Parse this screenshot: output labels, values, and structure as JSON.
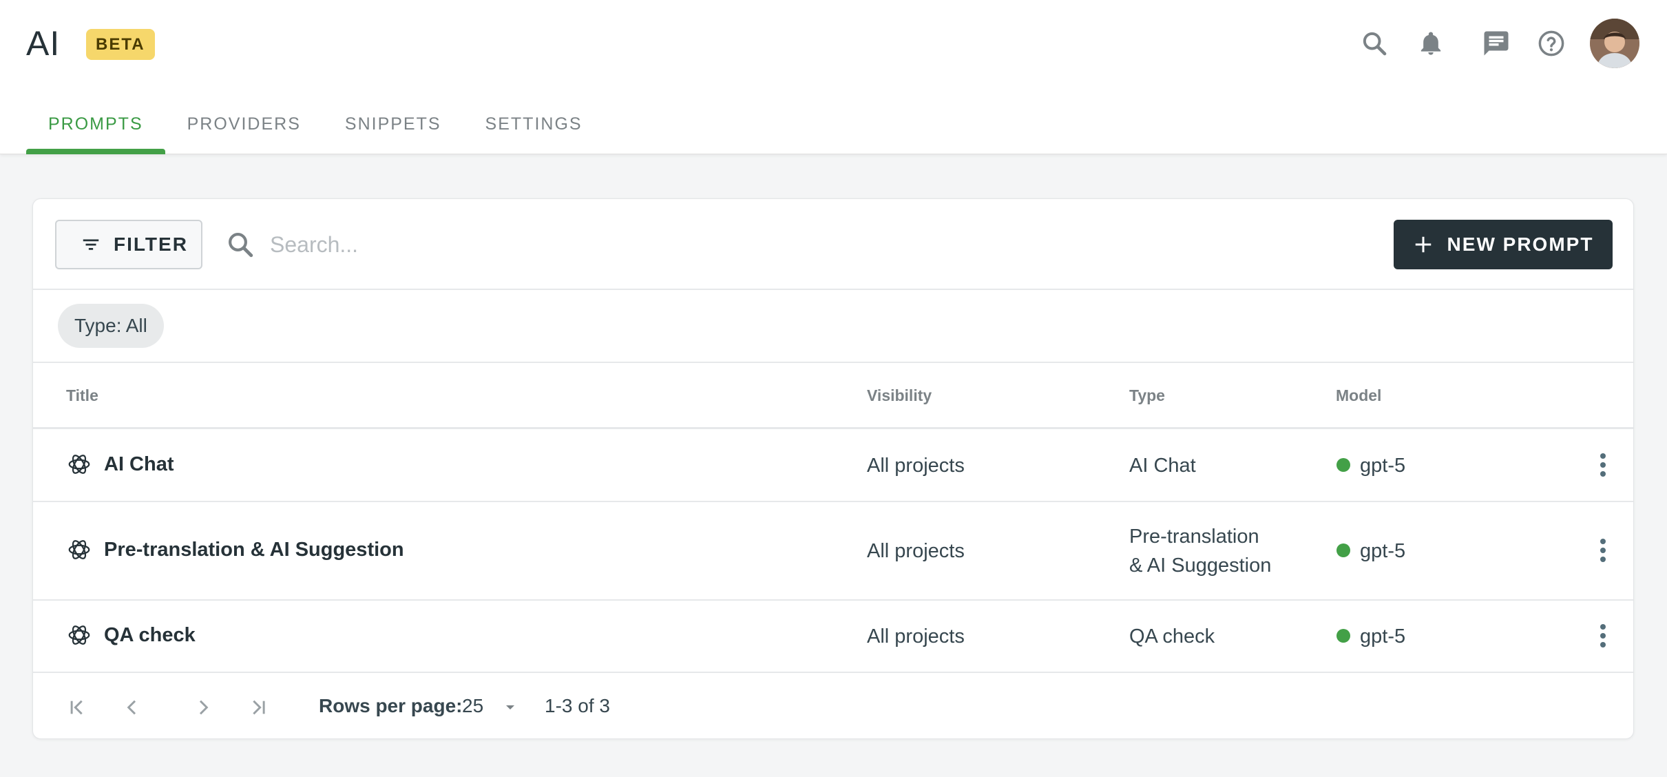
{
  "header": {
    "app_title": "AI",
    "badge": "BETA",
    "icons": [
      "search-icon",
      "bell-icon",
      "chat-icon",
      "help-icon"
    ],
    "avatar": "user-avatar"
  },
  "tabs": [
    {
      "label": "PROMPTS",
      "active": true
    },
    {
      "label": "PROVIDERS",
      "active": false
    },
    {
      "label": "SNIPPETS",
      "active": false
    },
    {
      "label": "SETTINGS",
      "active": false
    }
  ],
  "toolbar": {
    "filter_label": "FILTER",
    "search_placeholder": "Search...",
    "new_prompt_label": "NEW PROMPT"
  },
  "filters": {
    "chip_label": "Type: All"
  },
  "table": {
    "columns": [
      "Title",
      "Visibility",
      "Type",
      "Model"
    ],
    "rows": [
      {
        "title": "AI Chat",
        "visibility": "All projects",
        "type_line1": "AI Chat",
        "type_line2": "",
        "model": "gpt-5"
      },
      {
        "title": "Pre-translation & AI Suggestion",
        "visibility": "All projects",
        "type_line1": "Pre-translation",
        "type_line2": "& AI Suggestion",
        "model": "gpt-5"
      },
      {
        "title": "QA check",
        "visibility": "All projects",
        "type_line1": "QA check",
        "type_line2": "",
        "model": "gpt-5"
      }
    ]
  },
  "pagination": {
    "rows_per_page_label": "Rows per page:",
    "rows_per_page_value": "25",
    "range": "1-3 of 3"
  },
  "colors": {
    "accent_green": "#43a047",
    "dark": "#263238",
    "beta_badge": "#f6d76b"
  }
}
